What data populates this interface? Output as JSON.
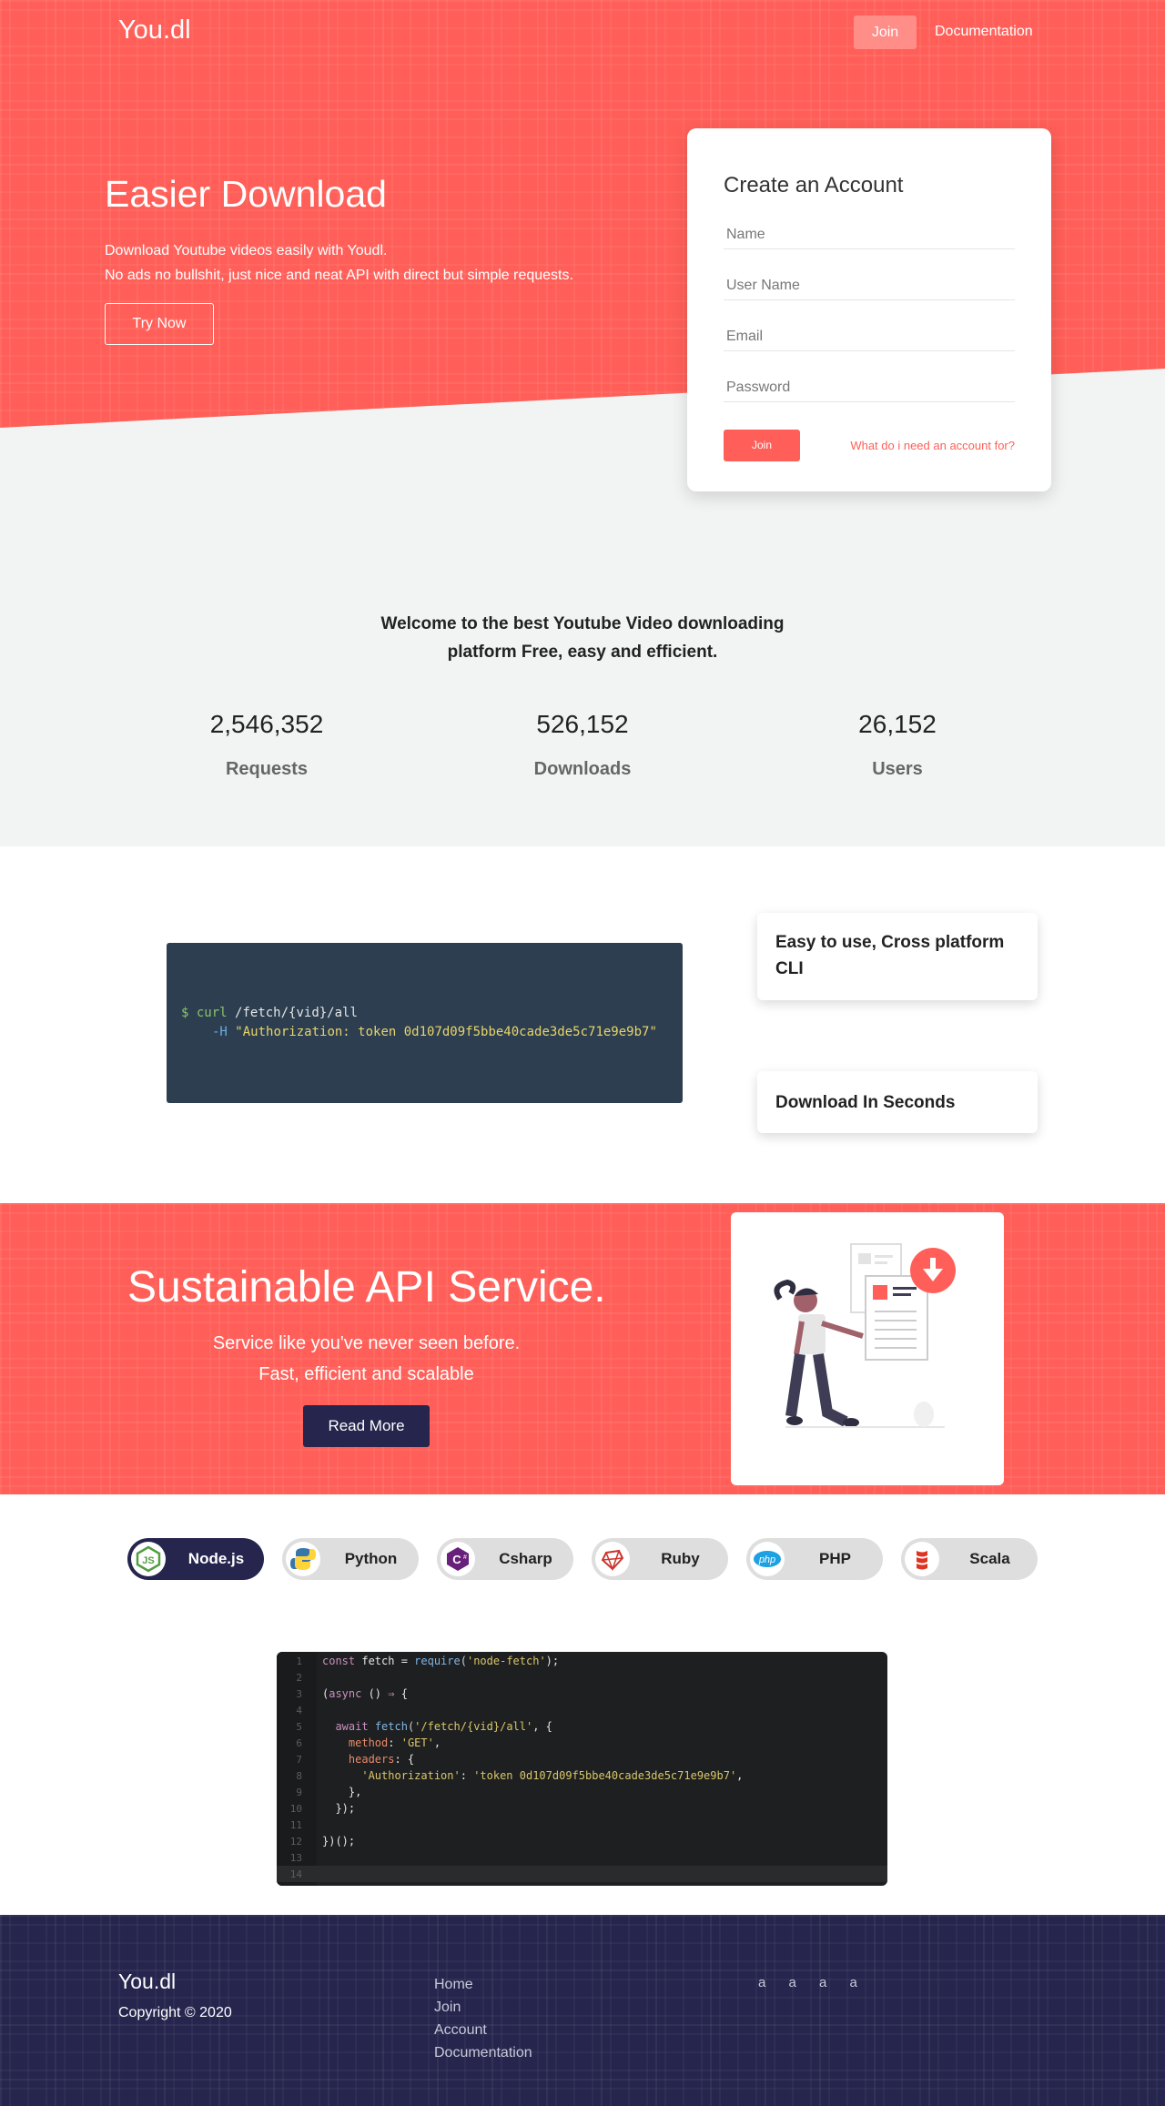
{
  "nav": {
    "brand": "You.dl",
    "join": "Join",
    "documentation": "Documentation"
  },
  "hero": {
    "title": "Easier Download",
    "line1": "Download Youtube videos easily with Youdl.",
    "line2": "No ads no bullshit, just nice and neat API with direct but simple requests.",
    "cta": "Try Now"
  },
  "signup": {
    "title": "Create an Account",
    "name_placeholder": "Name",
    "username_placeholder": "User Name",
    "email_placeholder": "Email",
    "password_placeholder": "Password",
    "join": "Join",
    "why": "What do i need an account for?"
  },
  "welcome": {
    "line1": "Welcome to the best Youtube Video downloading",
    "line2": "platform Free, easy and efficient."
  },
  "stats": [
    {
      "value": "2,546,352",
      "label": "Requests"
    },
    {
      "value": "526,152",
      "label": "Downloads"
    },
    {
      "value": "26,152",
      "label": "Users"
    }
  ],
  "terminal": {
    "prompt": "$",
    "cmd": "curl",
    "path": "/fetch/{vid}/all",
    "flag": "-H",
    "header": "\"Authorization: token 0d107d09f5bbe40cade3de5c71e9e9b7\""
  },
  "features": {
    "card1": "Easy to use, Cross platform CLI",
    "card2": "Download In Seconds"
  },
  "api": {
    "title": "Sustainable API Service.",
    "line1": "Service like you've never seen before.",
    "line2": "Fast, efficient and scalable",
    "cta": "Read More"
  },
  "languages": [
    {
      "name": "Node.js",
      "active": true,
      "icon": "nodejs-icon"
    },
    {
      "name": "Python",
      "active": false,
      "icon": "python-icon"
    },
    {
      "name": "Csharp",
      "active": false,
      "icon": "csharp-icon"
    },
    {
      "name": "Ruby",
      "active": false,
      "icon": "ruby-icon"
    },
    {
      "name": "PHP",
      "active": false,
      "icon": "php-icon"
    },
    {
      "name": "Scala",
      "active": false,
      "icon": "scala-icon"
    }
  ],
  "code": {
    "line_numbers": [
      "1",
      "2",
      "3",
      "4",
      "5",
      "6",
      "7",
      "8",
      "9",
      "10",
      "11",
      "12",
      "13",
      "14"
    ],
    "l1_kw": "const",
    "l1_var": " fetch = ",
    "l1_fn": "require",
    "l1_str": "'node-fetch'",
    "l1_end": ");",
    "l3_a": "(",
    "l3_kw": "async",
    "l3_b": " () ",
    "l3_arrow": "⇒",
    "l3_c": " {",
    "l5_kw": "await",
    "l5_fn": "fetch",
    "l5_str": "'/fetch/{vid}/all'",
    "l5_end": ", {",
    "l6_prop": "method",
    "l6_str": "'GET'",
    "l7_prop": "headers",
    "l7_end": ": {",
    "l8_str1": "'Authorization'",
    "l8_str2": "'token 0d107d09f5bbe40cade3de5c71e9e9b7'",
    "l9": "},",
    "l10": "});",
    "l12": "})();"
  },
  "footer": {
    "brand": "You.dl",
    "copyright": "Copyright © 2020",
    "links": [
      "Home",
      "Join",
      "Account",
      "Documentation"
    ],
    "social": [
      "a",
      "a",
      "a",
      "a"
    ]
  },
  "colors": {
    "coral": "#ff5f58",
    "navy": "#25254e",
    "terminal_bg": "#2d3e50",
    "editor_bg": "#1e1f20"
  }
}
